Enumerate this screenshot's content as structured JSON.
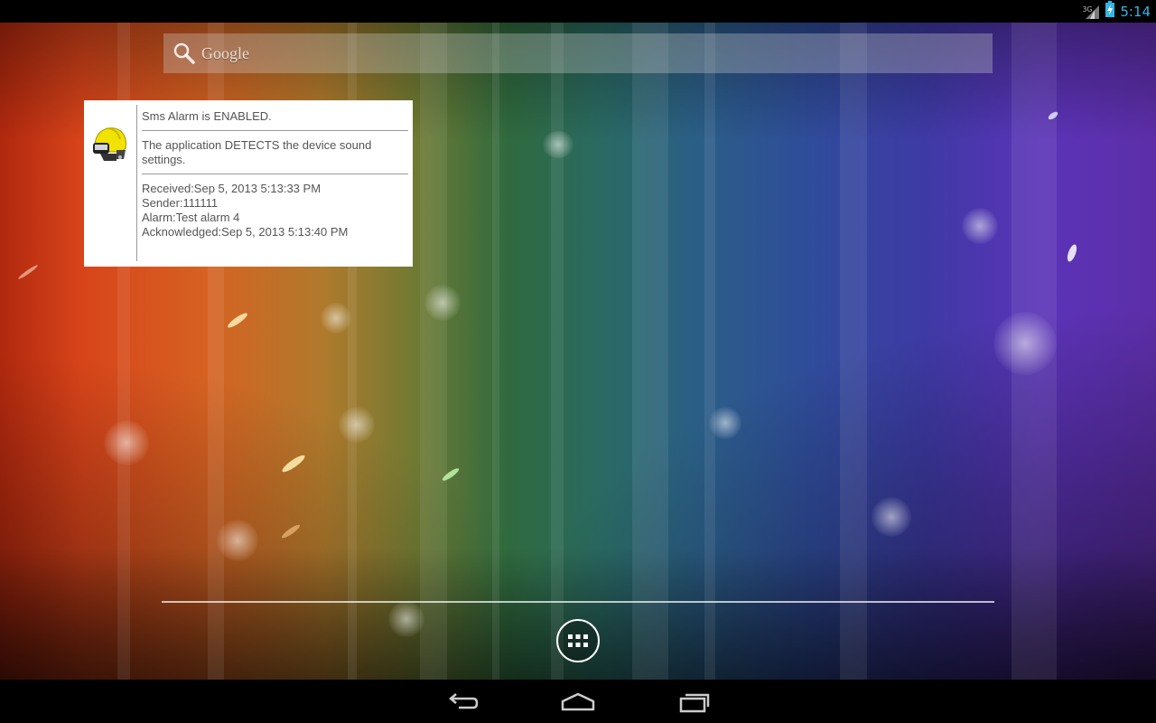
{
  "status_bar": {
    "network_type": "3G",
    "time": "5:14",
    "icons": [
      "signal-icon",
      "battery-charging-icon"
    ]
  },
  "search": {
    "label": "Google",
    "icon": "search-icon"
  },
  "widget": {
    "icon": "firefighter-helmet-icon",
    "status_line": "Sms Alarm is ENABLED.",
    "sound_line_1": "The application DETECTS the device sound",
    "sound_line_2": "settings.",
    "received": "Received:Sep 5, 2013 5:13:33 PM",
    "sender": "Sender:111111",
    "alarm": "Alarm:Test alarm 4",
    "acknowledged": "Acknowledged:Sep 5, 2013 5:13:40 PM"
  },
  "dock": {
    "apps_icon": "all-apps-grid-icon"
  },
  "nav_bar": {
    "icons": [
      "back-icon",
      "home-icon",
      "recent-apps-icon"
    ]
  },
  "colors": {
    "clock": "#33b5e5",
    "widget_text": "#555555",
    "widget_background": "#ffffff"
  }
}
